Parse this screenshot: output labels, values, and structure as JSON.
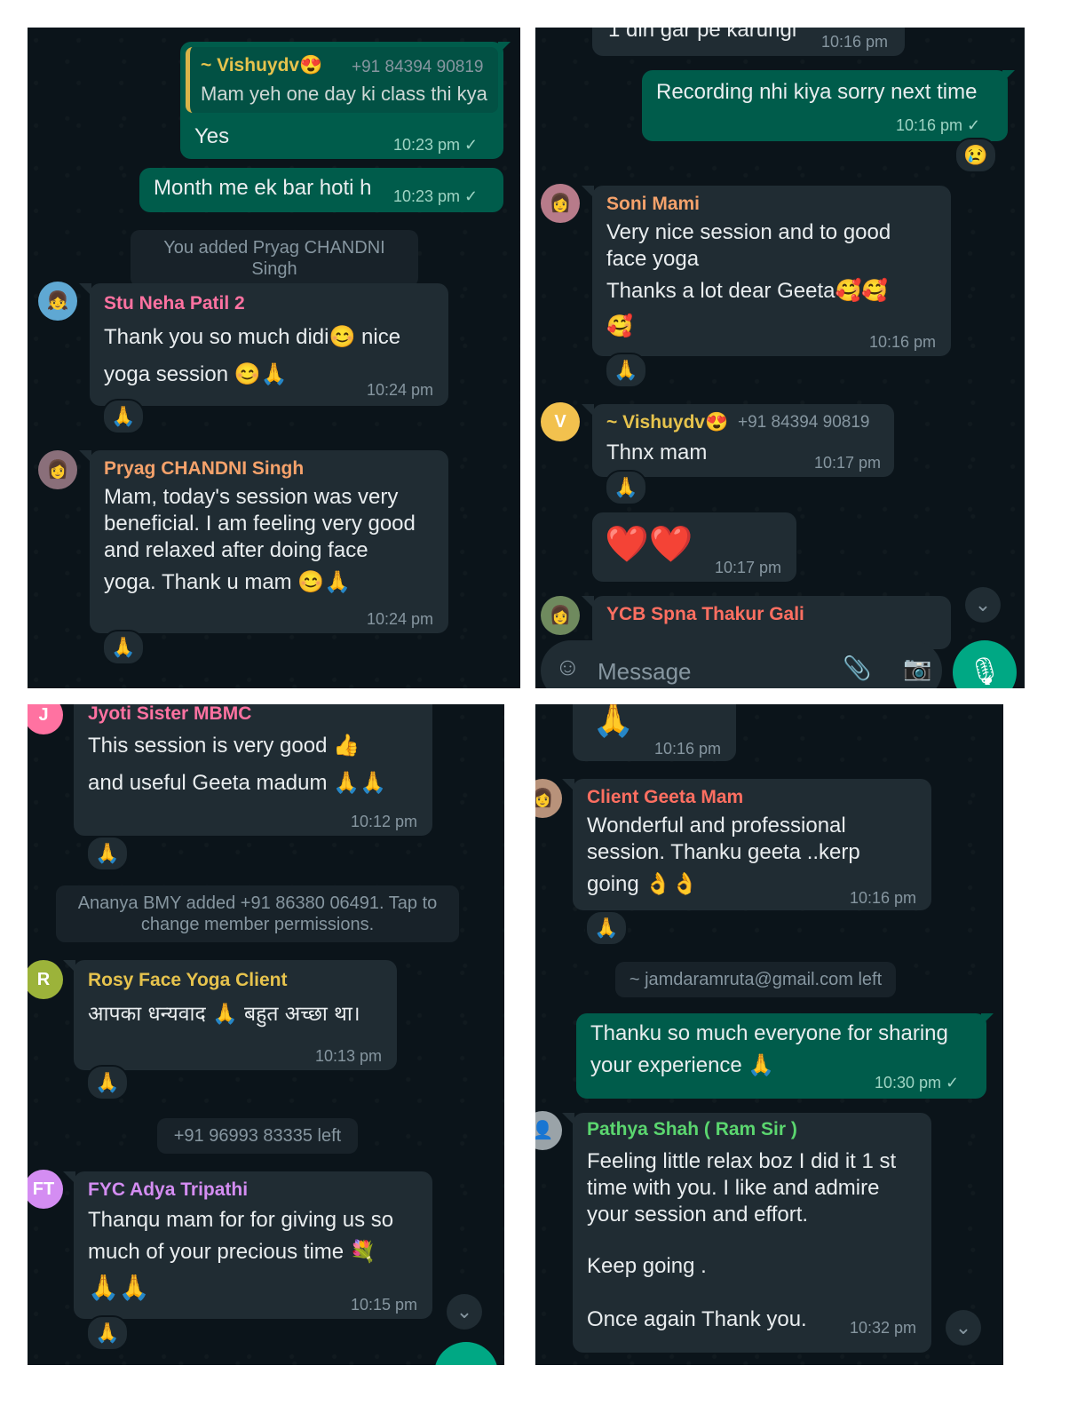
{
  "panel1": {
    "quote_name": "~ Vishuydv😍",
    "quote_phone": "+91 84394 90819",
    "quote_text": "Mam yeh one day ki class thi kya",
    "msg_yes": "Yes",
    "msg_yes_time": "10:23 pm ✓",
    "msg_month": "Month me ek bar hoti h",
    "msg_month_time": "10:23 pm ✓",
    "sys_added": "You added Pryag CHANDNI Singh",
    "neha_name": "Stu Neha Patil 2",
    "neha_line1": "Thank you so much didi😊 nice",
    "neha_line2": "yoga session 😊🙏",
    "neha_time": "10:24 pm",
    "neha_react": "🙏",
    "pryag_name": "Pryag CHANDNI Singh",
    "pryag_line1": "Mam, today's session was very",
    "pryag_line2": "beneficial. I am feeling very good",
    "pryag_line3": "and  relaxed after doing face",
    "pryag_line4": "yoga. Thank u mam 😊🙏",
    "pryag_time": "10:24 pm",
    "pryag_react": "🙏"
  },
  "panel2": {
    "top_partial": "1 din gar pe karungi",
    "top_time": "10:16 pm",
    "rec_text": "Recording nhi kiya sorry next time",
    "rec_time": "10:16 pm ✓",
    "rec_react": "😢",
    "soni_name": "Soni Mami",
    "soni_line1": "Very nice session and to good",
    "soni_line2": "face yoga",
    "soni_line3": "Thanks a lot dear Geeta🥰🥰",
    "soni_line4": "🥰",
    "soni_time": "10:16 pm",
    "soni_react": "🙏",
    "vish_avatar": "V",
    "vish_name": "~ Vishuydv😍",
    "vish_phone": "+91 84394 90819",
    "vish_text": "Thnx mam",
    "vish_time": "10:17 pm",
    "vish_react": "🙏",
    "hearts": "❤️❤️",
    "hearts_time": "10:17 pm",
    "ycb_name": "YCB Spna Thakur Gali",
    "composer_placeholder": "Message"
  },
  "panel3": {
    "jyoti_avatar": "J",
    "jyoti_name": "Jyoti Sister MBMC",
    "jyoti_line1": "This session is very good 👍",
    "jyoti_line2": "and useful Geeta madum 🙏🙏",
    "jyoti_time": "10:12 pm",
    "jyoti_react": "🙏",
    "sys_ananya_1": "Ananya  BMY added +91 86380 06491. Tap to",
    "sys_ananya_2": "change member permissions.",
    "rosy_avatar": "R",
    "rosy_name": "Rosy Face Yoga Client",
    "rosy_text": "आपका धन्यवाद 🙏 बहुत अच्छा था।",
    "rosy_time": "10:13 pm",
    "rosy_react": "🙏",
    "sys_left": "+91 96993 83335 left",
    "fyc_avatar": "FT",
    "fyc_name": "FYC Adya Tripathi",
    "fyc_line1": "Thanqu mam for for giving us so",
    "fyc_line2": "much of your precious time 💐",
    "fyc_line3": "🙏🙏",
    "fyc_time": "10:15 pm",
    "fyc_react": "🙏"
  },
  "panel4": {
    "top_emoji": "🙏",
    "top_time": "10:16 pm",
    "geeta_name": "Client Geeta Mam",
    "geeta_line1": "Wonderful and professional",
    "geeta_line2": "session. Thanku geeta ..kerp",
    "geeta_line3": "going 👌👌",
    "geeta_time": "10:16 pm",
    "geeta_react": "🙏",
    "sys_left": "~ jamdaramruta@gmail.com left",
    "thanku_line1": "Thanku so much everyone for sharing",
    "thanku_line2": "your experience 🙏",
    "thanku_time": "10:30 pm ✓",
    "pathya_name": "Pathya Shah ( Ram Sir )",
    "pathya_line1": "Feeling little relax boz I  did it 1 st",
    "pathya_line2": "time with you. I like and admire",
    "pathya_line3": "your session and effort.",
    "pathya_line4": "Keep going .",
    "pathya_line5": "Once again Thank you.",
    "pathya_time": "10:32 pm"
  },
  "colors": {
    "background": "#0b141a",
    "incoming": "#202c33",
    "outgoing": "#005c4b",
    "name_pink": "#ff72a1",
    "name_orange": "#f5a26b",
    "name_yellow": "#e6c34d",
    "name_purple": "#d48df2",
    "name_green": "#5bd66f",
    "name_red": "#ff6f61"
  }
}
